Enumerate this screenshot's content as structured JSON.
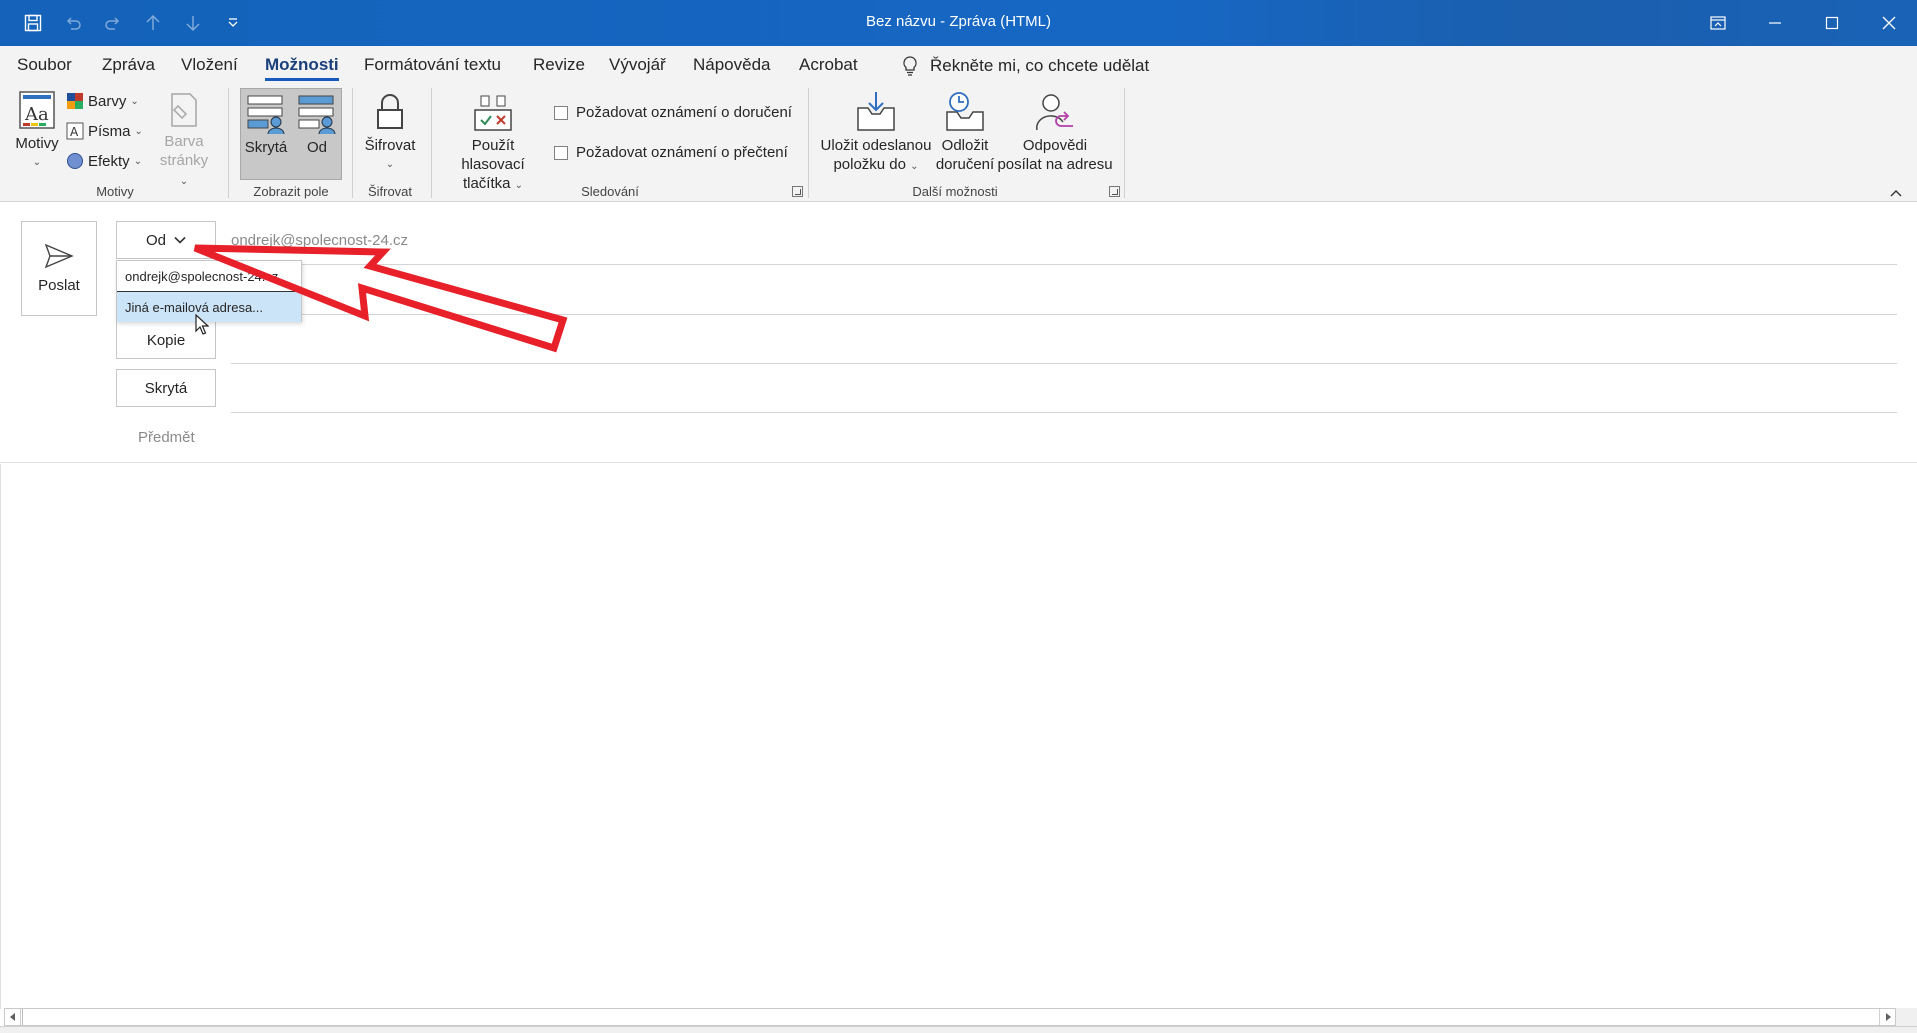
{
  "window": {
    "title": "Bez názvu  -  Zpráva (HTML)"
  },
  "menu": {
    "tabs": [
      {
        "label": "Soubor"
      },
      {
        "label": "Zpráva"
      },
      {
        "label": "Vložení"
      },
      {
        "label": "Možnosti",
        "active": true
      },
      {
        "label": "Formátování textu"
      },
      {
        "label": "Revize"
      },
      {
        "label": "Vývojář"
      },
      {
        "label": "Nápověda"
      },
      {
        "label": "Acrobat"
      }
    ],
    "tell_me": "Řekněte mi, co chcete udělat"
  },
  "ribbon": {
    "motivy": {
      "themes_label": "Motivy",
      "colors_label": "Barvy",
      "fonts_label": "Písma",
      "effects_label": "Efekty",
      "page_color_line1": "Barva",
      "page_color_line2": "stránky",
      "group_label": "Motivy"
    },
    "show_fields": {
      "bcc_label": "Skrytá",
      "from_label": "Od",
      "group_label": "Zobrazit pole"
    },
    "encrypt": {
      "label": "Šifrovat",
      "group_label": "Šifrovat"
    },
    "tracking": {
      "voting_line1": "Použít hlasovací",
      "voting_line2": "tlačítka",
      "delivery_receipt": "Požadovat oznámení o doručení",
      "read_receipt": "Požadovat oznámení o přečtení",
      "group_label": "Sledování"
    },
    "more_options": {
      "save_sent_line1": "Uložit odeslanou",
      "save_sent_line2": "položku do",
      "delay_line1": "Odložit",
      "delay_line2": "doručení",
      "reply_to_line1": "Odpovědi",
      "reply_to_line2": "posílat na adresu",
      "group_label": "Další možnosti"
    }
  },
  "compose": {
    "send_label": "Poslat",
    "from_button": "Od",
    "from_value": "ondrejk@spolecnost-24.cz",
    "cc_button": "Kopie",
    "bcc_button": "Skrytá",
    "subject_label": "Předmět",
    "from_dropdown": {
      "items": [
        {
          "label": "ondrejk@spolecnost-24.cz"
        },
        {
          "label": "Jiná e-mailová adresa...",
          "highlighted": true
        }
      ]
    }
  },
  "colors": {
    "titlebar": "#1565c0",
    "active_tab_underline": "#185abd",
    "annotation_arrow": "#e8202a",
    "dropdown_highlight": "#cce4f7"
  }
}
